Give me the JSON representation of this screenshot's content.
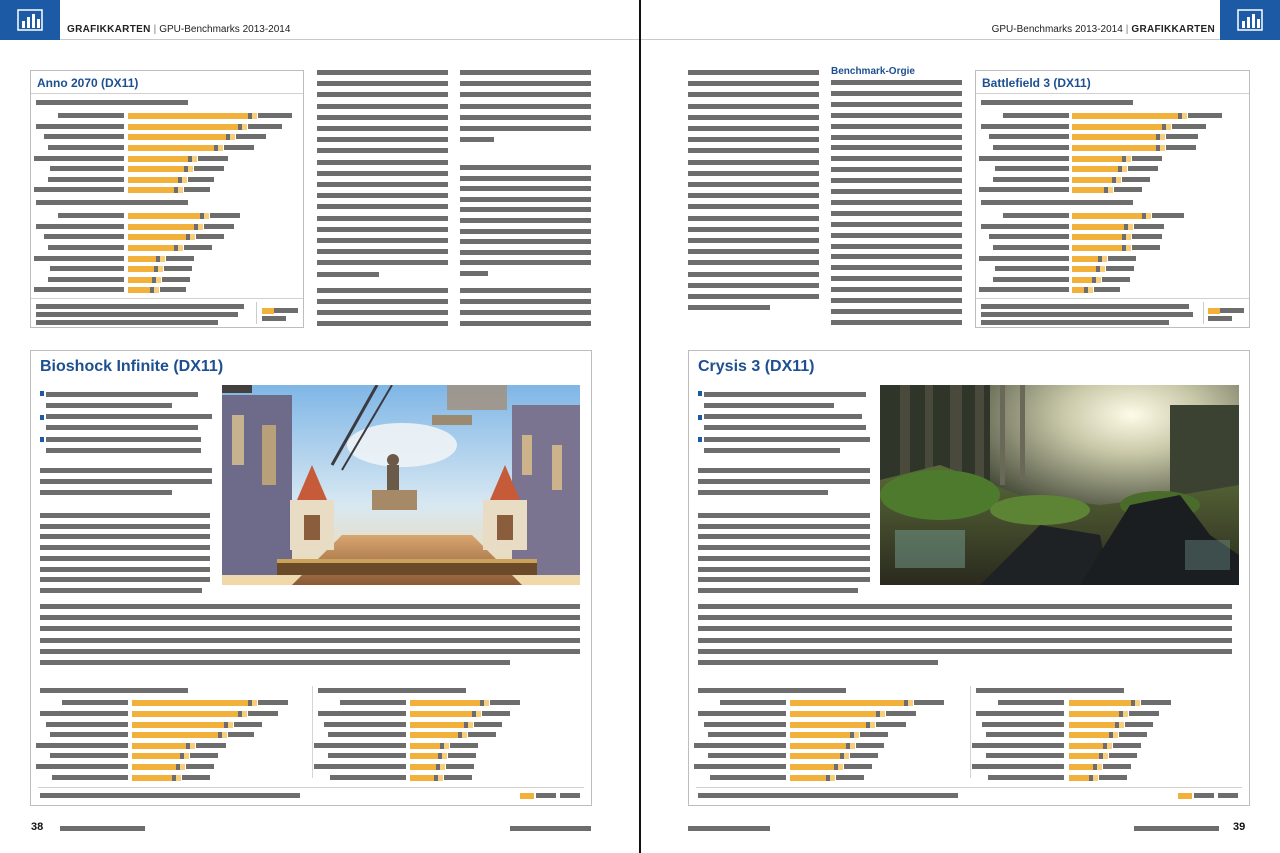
{
  "section": "GRAFIKKARTEN",
  "series": "GPU-Benchmarks 2013-2014",
  "subheading": "Benchmark-Orgie",
  "charts": {
    "anno": "Anno 2070 (DX11)",
    "battlefield": "Battlefield 3 (DX11)",
    "bioshock": "Bioshock Infinite (DX11)",
    "crysis": "Crysis 3 (DX11)"
  },
  "page_numbers": {
    "left": "38",
    "right": "39"
  },
  "icons": [
    "bar-chart-logo-icon",
    "bullet-arrow-icon"
  ],
  "colors": {
    "brand_blue": "#1d5aa6",
    "bar_orange": "#f2b13a",
    "text_gray": "#6d6d6d"
  }
}
